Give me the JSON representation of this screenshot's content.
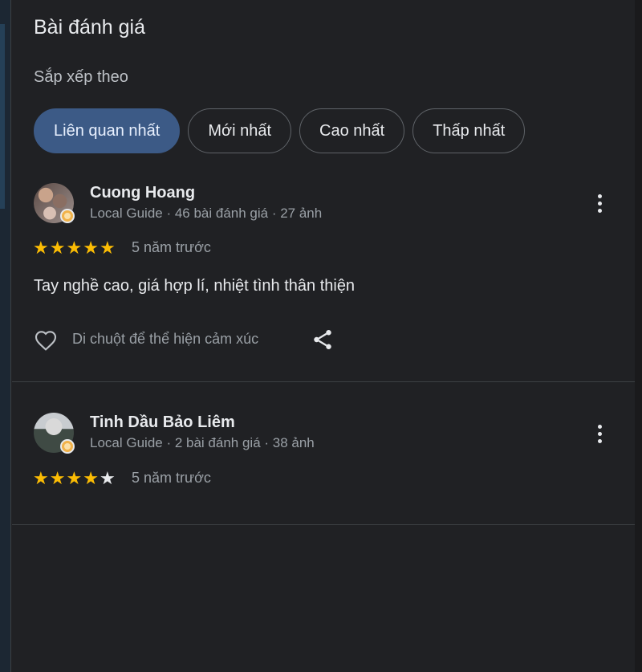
{
  "panel": {
    "title": "Bài đánh giá",
    "sort_label": "Sắp xếp theo",
    "sort_chips": [
      {
        "label": "Liên quan nhất",
        "active": true
      },
      {
        "label": "Mới nhất",
        "active": false
      },
      {
        "label": "Cao nhất",
        "active": false
      },
      {
        "label": "Thấp nhất",
        "active": false
      }
    ]
  },
  "reviews": [
    {
      "name": "Cuong Hoang",
      "meta": "Local Guide · 46 bài đánh giá · 27 ảnh",
      "rating": 5,
      "date": "5 năm trước",
      "text": "Tay nghề cao, giá hợp lí, nhiệt tình thân thiện",
      "reaction_label": "Di chuột để thể hiện cảm xúc",
      "icons": {
        "more": "more-vert-icon",
        "like": "heart-icon",
        "share": "share-icon"
      }
    },
    {
      "name": "Tinh Dầu Bảo Liêm",
      "meta": "Local Guide · 2 bài đánh giá · 38 ảnh",
      "rating": 4,
      "date": "5 năm trước",
      "icons": {
        "more": "more-vert-icon"
      }
    }
  ],
  "colors": {
    "background": "#202124",
    "active_chip": "#3c5a86",
    "star": "#fbbc04",
    "text_primary": "#e8eaed",
    "text_secondary": "#9aa0a6"
  }
}
